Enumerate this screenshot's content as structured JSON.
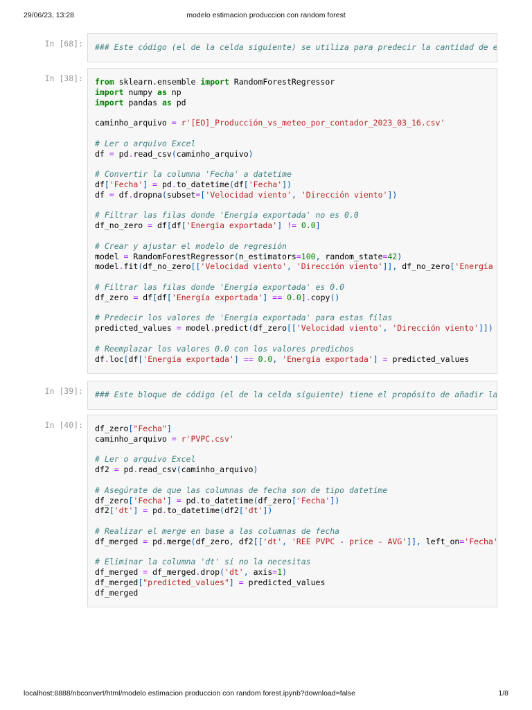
{
  "header": {
    "datetime": "29/06/23, 13:28",
    "title": "modelo estimacion produccion con random forest"
  },
  "footer": {
    "url": "localhost:8888/nbconvert/html/modelo estimacion produccion con random forest.ipynb?download=false",
    "page": "1/8"
  },
  "cells": [
    {
      "prompt": "In [68]:",
      "lines": [
        [
          [
            "c",
            "### Este código (el de la celda siguiente) se utiliza para predecir la cantidad de energía exportada"
          ]
        ]
      ]
    },
    {
      "prompt": "In [38]:",
      "lines": [
        [
          [
            "k",
            "from"
          ],
          [
            "t",
            " sklearn.ensemble "
          ],
          [
            "k",
            "import"
          ],
          [
            "t",
            " RandomForestRegressor"
          ]
        ],
        [
          [
            "k",
            "import"
          ],
          [
            "t",
            " numpy "
          ],
          [
            "k",
            "as"
          ],
          [
            "t",
            " np"
          ]
        ],
        [
          [
            "k",
            "import"
          ],
          [
            "t",
            " pandas "
          ],
          [
            "k",
            "as"
          ],
          [
            "t",
            " pd"
          ]
        ],
        [],
        [
          [
            "t",
            "caminho_arquivo "
          ],
          [
            "o",
            "="
          ],
          [
            "t",
            " "
          ],
          [
            "s",
            "r'[EO]_Producción_vs_meteo_por_contador_2023_03_16.csv'"
          ]
        ],
        [],
        [
          [
            "c",
            "# Ler o arquivo Excel"
          ]
        ],
        [
          [
            "t",
            "df "
          ],
          [
            "o",
            "="
          ],
          [
            "t",
            " pd"
          ],
          [
            "o",
            "."
          ],
          [
            "t",
            "read_csv"
          ],
          [
            "p",
            "("
          ],
          [
            "t",
            "caminho_arquivo"
          ],
          [
            "p",
            ")"
          ]
        ],
        [],
        [
          [
            "c",
            "# Convertir la columna 'Fecha' a datetime"
          ]
        ],
        [
          [
            "t",
            "df"
          ],
          [
            "p",
            "["
          ],
          [
            "s",
            "'Fecha'"
          ],
          [
            "p",
            "]"
          ],
          [
            "t",
            " "
          ],
          [
            "o",
            "="
          ],
          [
            "t",
            " pd"
          ],
          [
            "o",
            "."
          ],
          [
            "t",
            "to_datetime"
          ],
          [
            "p",
            "("
          ],
          [
            "t",
            "df"
          ],
          [
            "p",
            "["
          ],
          [
            "s",
            "'Fecha'"
          ],
          [
            "p",
            "])"
          ]
        ],
        [
          [
            "t",
            "df "
          ],
          [
            "o",
            "="
          ],
          [
            "t",
            " df"
          ],
          [
            "o",
            "."
          ],
          [
            "t",
            "dropna"
          ],
          [
            "p",
            "("
          ],
          [
            "t",
            "subset"
          ],
          [
            "o",
            "="
          ],
          [
            "p",
            "["
          ],
          [
            "s",
            "'Velocidad viento'"
          ],
          [
            "p",
            ", "
          ],
          [
            "s",
            "'Dirección viento'"
          ],
          [
            "p",
            "])"
          ]
        ],
        [],
        [
          [
            "c",
            "# Filtrar las filas donde 'Energía exportada' no es 0.0"
          ]
        ],
        [
          [
            "t",
            "df_no_zero "
          ],
          [
            "o",
            "="
          ],
          [
            "t",
            " df"
          ],
          [
            "p",
            "["
          ],
          [
            "t",
            "df"
          ],
          [
            "p",
            "["
          ],
          [
            "s",
            "'Energía exportada'"
          ],
          [
            "p",
            "]"
          ],
          [
            "t",
            " "
          ],
          [
            "o",
            "!="
          ],
          [
            "t",
            " "
          ],
          [
            "n",
            "0.0"
          ],
          [
            "p",
            "]"
          ]
        ],
        [],
        [
          [
            "c",
            "# Crear y ajustar el modelo de regresión"
          ]
        ],
        [
          [
            "t",
            "model "
          ],
          [
            "o",
            "="
          ],
          [
            "t",
            " RandomForestRegressor"
          ],
          [
            "p",
            "("
          ],
          [
            "t",
            "n_estimators"
          ],
          [
            "o",
            "="
          ],
          [
            "n",
            "100"
          ],
          [
            "p",
            ", "
          ],
          [
            "t",
            "random_state"
          ],
          [
            "o",
            "="
          ],
          [
            "n",
            "42"
          ],
          [
            "p",
            ")"
          ]
        ],
        [
          [
            "t",
            "model"
          ],
          [
            "o",
            "."
          ],
          [
            "t",
            "fit"
          ],
          [
            "p",
            "("
          ],
          [
            "t",
            "df_no_zero"
          ],
          [
            "p",
            "[["
          ],
          [
            "s",
            "'Velocidad viento'"
          ],
          [
            "p",
            ", "
          ],
          [
            "s",
            "'Dirección viento'"
          ],
          [
            "p",
            "]], "
          ],
          [
            "t",
            "df_no_zero"
          ],
          [
            "p",
            "["
          ],
          [
            "s",
            "'Energía exportada'"
          ],
          [
            "p",
            "])"
          ]
        ],
        [],
        [
          [
            "c",
            "# Filtrar las filas donde 'Energía exportada' es 0.0"
          ]
        ],
        [
          [
            "t",
            "df_zero "
          ],
          [
            "o",
            "="
          ],
          [
            "t",
            " df"
          ],
          [
            "p",
            "["
          ],
          [
            "t",
            "df"
          ],
          [
            "p",
            "["
          ],
          [
            "s",
            "'Energía exportada'"
          ],
          [
            "p",
            "]"
          ],
          [
            "t",
            " "
          ],
          [
            "o",
            "=="
          ],
          [
            "t",
            " "
          ],
          [
            "n",
            "0.0"
          ],
          [
            "p",
            "]"
          ],
          [
            "o",
            "."
          ],
          [
            "t",
            "copy"
          ],
          [
            "p",
            "()"
          ]
        ],
        [],
        [
          [
            "c",
            "# Predecir los valores de 'Energía exportada' para estas filas"
          ]
        ],
        [
          [
            "t",
            "predicted_values "
          ],
          [
            "o",
            "="
          ],
          [
            "t",
            " model"
          ],
          [
            "o",
            "."
          ],
          [
            "t",
            "predict"
          ],
          [
            "p",
            "("
          ],
          [
            "t",
            "df_zero"
          ],
          [
            "p",
            "[["
          ],
          [
            "s",
            "'Velocidad viento'"
          ],
          [
            "p",
            ", "
          ],
          [
            "s",
            "'Dirección viento'"
          ],
          [
            "p",
            "]])"
          ]
        ],
        [],
        [
          [
            "c",
            "# Reemplazar los valores 0.0 con los valores predichos"
          ]
        ],
        [
          [
            "t",
            "df"
          ],
          [
            "o",
            "."
          ],
          [
            "t",
            "loc"
          ],
          [
            "p",
            "["
          ],
          [
            "t",
            "df"
          ],
          [
            "p",
            "["
          ],
          [
            "s",
            "'Energía exportada'"
          ],
          [
            "p",
            "]"
          ],
          [
            "t",
            " "
          ],
          [
            "o",
            "=="
          ],
          [
            "t",
            " "
          ],
          [
            "n",
            "0.0"
          ],
          [
            "p",
            ", "
          ],
          [
            "s",
            "'Energía exportada'"
          ],
          [
            "p",
            "]"
          ],
          [
            "t",
            " "
          ],
          [
            "o",
            "="
          ],
          [
            "t",
            " predicted_values"
          ]
        ]
      ]
    },
    {
      "prompt": "In [39]:",
      "lines": [
        [
          [
            "c",
            "### Este bloque de código (el de la celda siguiente) tiene el propósito de añadir la información"
          ]
        ]
      ]
    },
    {
      "prompt": "In [40]:",
      "lines": [
        [
          [
            "t",
            "df_zero"
          ],
          [
            "p",
            "["
          ],
          [
            "s",
            "\"Fecha\""
          ],
          [
            "p",
            "]"
          ]
        ],
        [
          [
            "t",
            "caminho_arquivo "
          ],
          [
            "o",
            "="
          ],
          [
            "t",
            " "
          ],
          [
            "s",
            "r'PVPC.csv'"
          ]
        ],
        [],
        [
          [
            "c",
            "# Ler o arquivo Excel"
          ]
        ],
        [
          [
            "t",
            "df2 "
          ],
          [
            "o",
            "="
          ],
          [
            "t",
            " pd"
          ],
          [
            "o",
            "."
          ],
          [
            "t",
            "read_csv"
          ],
          [
            "p",
            "("
          ],
          [
            "t",
            "caminho_arquivo"
          ],
          [
            "p",
            ")"
          ]
        ],
        [],
        [
          [
            "c",
            "# Asegúrate de que las columnas de fecha son de tipo datetime"
          ]
        ],
        [
          [
            "t",
            "df_zero"
          ],
          [
            "p",
            "["
          ],
          [
            "s",
            "'Fecha'"
          ],
          [
            "p",
            "]"
          ],
          [
            "t",
            " "
          ],
          [
            "o",
            "="
          ],
          [
            "t",
            " pd"
          ],
          [
            "o",
            "."
          ],
          [
            "t",
            "to_datetime"
          ],
          [
            "p",
            "("
          ],
          [
            "t",
            "df_zero"
          ],
          [
            "p",
            "["
          ],
          [
            "s",
            "'Fecha'"
          ],
          [
            "p",
            "])"
          ]
        ],
        [
          [
            "t",
            "df2"
          ],
          [
            "p",
            "["
          ],
          [
            "s",
            "'dt'"
          ],
          [
            "p",
            "]"
          ],
          [
            "t",
            " "
          ],
          [
            "o",
            "="
          ],
          [
            "t",
            " pd"
          ],
          [
            "o",
            "."
          ],
          [
            "t",
            "to_datetime"
          ],
          [
            "p",
            "("
          ],
          [
            "t",
            "df2"
          ],
          [
            "p",
            "["
          ],
          [
            "s",
            "'dt'"
          ],
          [
            "p",
            "])"
          ]
        ],
        [],
        [
          [
            "c",
            "# Realizar el merge en base a las columnas de fecha"
          ]
        ],
        [
          [
            "t",
            "df_merged "
          ],
          [
            "o",
            "="
          ],
          [
            "t",
            " pd"
          ],
          [
            "o",
            "."
          ],
          [
            "t",
            "merge"
          ],
          [
            "p",
            "("
          ],
          [
            "t",
            "df_zero"
          ],
          [
            "p",
            ", "
          ],
          [
            "t",
            "df2"
          ],
          [
            "p",
            "[["
          ],
          [
            "s",
            "'dt'"
          ],
          [
            "p",
            ", "
          ],
          [
            "s",
            "'REE PVPC - price - AVG'"
          ],
          [
            "p",
            "]], "
          ],
          [
            "t",
            "left_on"
          ],
          [
            "o",
            "="
          ],
          [
            "s",
            "'Fecha'"
          ],
          [
            "p",
            ", "
          ]
        ],
        [],
        [
          [
            "c",
            "# Eliminar la columna 'dt' si no la necesitas"
          ]
        ],
        [
          [
            "t",
            "df_merged "
          ],
          [
            "o",
            "="
          ],
          [
            "t",
            " df_merged"
          ],
          [
            "o",
            "."
          ],
          [
            "t",
            "drop"
          ],
          [
            "p",
            "("
          ],
          [
            "s",
            "'dt'"
          ],
          [
            "p",
            ", "
          ],
          [
            "t",
            "axis"
          ],
          [
            "o",
            "="
          ],
          [
            "n",
            "1"
          ],
          [
            "p",
            ")"
          ]
        ],
        [
          [
            "t",
            "df_merged"
          ],
          [
            "p",
            "["
          ],
          [
            "s",
            "\"predicted_values\""
          ],
          [
            "p",
            "]"
          ],
          [
            "t",
            " "
          ],
          [
            "o",
            "="
          ],
          [
            "t",
            " predicted_values"
          ]
        ],
        [
          [
            "t",
            "df_merged"
          ]
        ]
      ]
    }
  ]
}
